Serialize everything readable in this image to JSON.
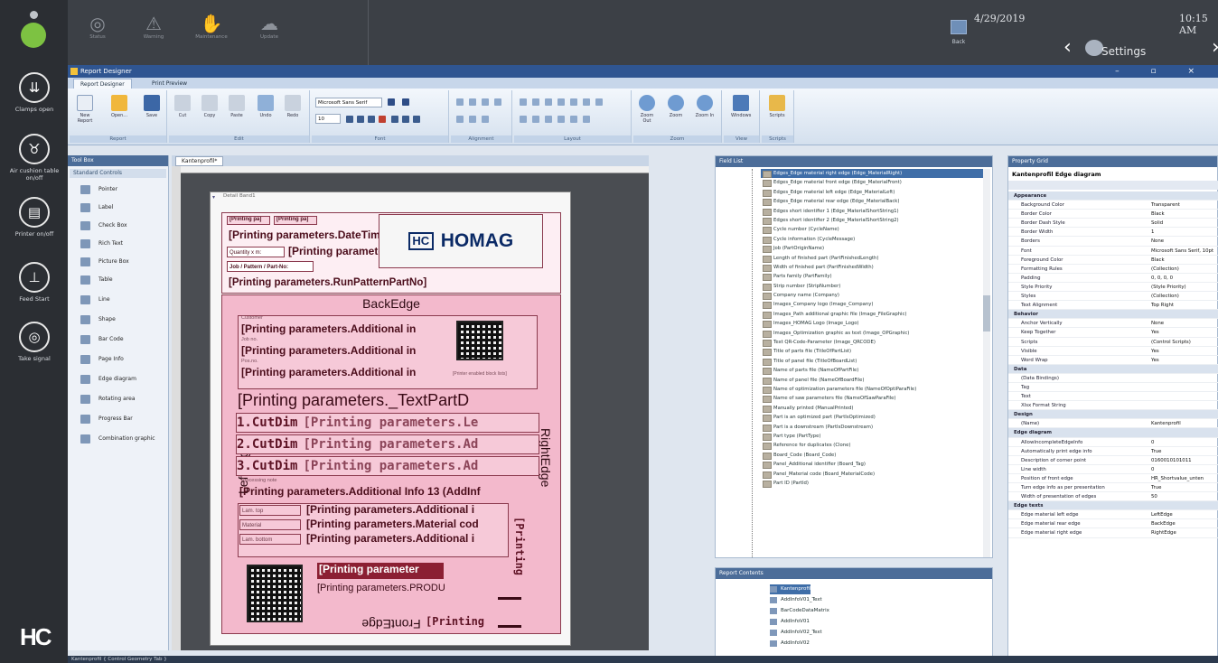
{
  "rail": {
    "buttons": [
      {
        "label": "Clamps open",
        "icon": "clamp-icon"
      },
      {
        "label": "Air cushion table on/off",
        "icon": "air-cushion-icon"
      },
      {
        "label": "Printer on/off",
        "icon": "printer-icon"
      },
      {
        "label": "Feed Start",
        "icon": "feed-start-icon"
      },
      {
        "label": "Take signal",
        "icon": "take-signal-icon"
      }
    ],
    "logo": "HC"
  },
  "topbar": {
    "icons": [
      {
        "label": "Status",
        "icon": "status-icon"
      },
      {
        "label": "Warning",
        "icon": "warning-icon"
      },
      {
        "label": "Maintenance",
        "icon": "maintenance-icon"
      },
      {
        "label": "Update",
        "icon": "update-icon"
      }
    ],
    "back_label": "Back",
    "date": "4/29/2019",
    "time": "10:15 AM",
    "settings_label": "Settings"
  },
  "window": {
    "title": "Report Designer",
    "controls": "– ▫ ×",
    "tabs": [
      "Report Designer",
      "Print Preview"
    ]
  },
  "ribbon": {
    "groups": [
      "Report",
      "Edit",
      "Font",
      "Alignment",
      "Layout",
      "Zoom",
      "View",
      "Scripts"
    ],
    "report_buttons": [
      "New Report",
      "Open...",
      "Save"
    ],
    "edit_buttons": [
      "Cut",
      "Copy",
      "Paste",
      "Undo",
      "Redo"
    ],
    "font_name": "Microsoft Sans Serif",
    "font_size": "10",
    "zoom_buttons": [
      "Zoom Out",
      "Zoom",
      "Zoom In"
    ],
    "view_buttons": [
      "Windows",
      "Scripts"
    ]
  },
  "toolbox": {
    "title": "Tool Box",
    "header": "Standard Controls",
    "items": [
      "Pointer",
      "Label",
      "Check Box",
      "Rich Text",
      "Picture Box",
      "Table",
      "Line",
      "Shape",
      "Bar Code",
      "Page Info",
      "Edge diagram",
      "Rotating area",
      "Progress Bar",
      "Combination graphic"
    ]
  },
  "document": {
    "tab": "Kantenprofil*",
    "band": "Detail Band1",
    "labels": {
      "printing1": "[Printing pa]",
      "printing2": "[Printing pa]",
      "datetime": "[Printing parameters.DateTim",
      "qty_label": "Quantity x m:",
      "qty_value": "[Printing parameter",
      "job_label": "Job / Pattern / Part-No:",
      "runpattern": "[Printing parameters.RunPatternPartNo]",
      "backedge": "BackEdge",
      "leftedge": "LeftEdge",
      "rightedge": "RightEdge",
      "frontedge": "FrontEdge",
      "customer_cap": "Customer",
      "add1": "[Printing parameters.Additional in",
      "jobno_cap": "Job no.",
      "add2": "[Printing parameters.Additional in",
      "posno_cap": "Pos.no.",
      "add3": "[Printing parameters.Additional in",
      "qr_caption": "[Printer enabled block lists]",
      "textpart": "[Printing parameters._TextPartD",
      "cutdim1": "1.CutDim",
      "cutdim1v": "[Printing parameters.Le",
      "cutdim2": "2.CutDim",
      "cutdim2v": "[Printing parameters.Ad",
      "cutdim3": "3.CutDim",
      "cutdim3v": "[Printing parameters.Ad",
      "processing_cap": "Processing note",
      "add13": "[Printing parameters.Additional Info 13 (AddInf",
      "lamtop_cap": "Lam. top",
      "lamtop": "[Printing parameters.Additional i",
      "material_cap": "Material",
      "material": "[Printing parameters.Material cod",
      "lambot_cap": "Lam. bottom",
      "lambot": "[Printing parameters.Additional i",
      "vertical": "[Printing",
      "pp_param": "[Printing parameter",
      "produ": "[Printing parameters.PRODU",
      "printing_bottom": "[Printing"
    },
    "logo_text": "HOMAG"
  },
  "fieldlist": {
    "title": "Field List",
    "items": [
      "Edges_Edge material right edge (Edge_MaterialRight)",
      "Edges_Edge material front edge (Edge_MaterialFront)",
      "Edges_Edge material left edge (Edge_MaterialLeft)",
      "Edges_Edge material rear edge (Edge_MaterialBack)",
      "Edges short identifier 1 (Edge_MaterialShortString1)",
      "Edges short identifier 2 (Edge_MaterialShortString2)",
      "Cycle number (CycleName)",
      "Cycle information (CycleMessage)",
      "Job (PartOriginName)",
      "Length of finished part (PartFinishedLength)",
      "Width of finished part (PartFinishedWidth)",
      "Parts family (PartFamily)",
      "Strip number (StripNumber)",
      "Company name (Company)",
      "Images_Company logo (Image_Company)",
      "Images_Path additional graphic file (Image_FileGraphic)",
      "Images_HOMAG Logo (Image_Logo)",
      "Images_Optimization graphic as text (Image_OPGraphic)",
      "Text QR-Code-Parameter (Image_QRCODE)",
      "Title of parts file (TitleOfPartList)",
      "Title of panel file (TitleOfBoardList)",
      "Name of parts file (NameOfPartFile)",
      "Name of panel file (NameOfBoardFile)",
      "Name of optimization parameters file (NameOfOptiParaFile)",
      "Name of saw parameters file (NameOfSawParaFile)",
      "Manually printed (ManualPrinted)",
      "Part is an optimized part (PartIsOptimized)",
      "Part is a downstream (PartIsDownstream)",
      "Part type (PartType)",
      "Reference for duplicates (Clone)",
      "Board_Code (Board_Code)",
      "Panel_Additional identifier (Board_Tag)",
      "Panel_Material code (Board_MaterialCode)",
      "Part ID (PartId)"
    ]
  },
  "report_content": {
    "title": "Report Contents",
    "items": [
      "Kantenprofil",
      "AddInfoV01_Text",
      "BarCodeDataMatrix",
      "AddInfoV01",
      "AddInfoV02_Text",
      "AddInfoV02"
    ]
  },
  "property_grid": {
    "title": "Property Grid",
    "object_name": "Kantenprofil Edge diagram",
    "rows": [
      {
        "k": "Appearance",
        "v": "",
        "cat": true
      },
      {
        "k": "Background Color",
        "v": "Transparent"
      },
      {
        "k": "Border Color",
        "v": "Black"
      },
      {
        "k": "Border Dash Style",
        "v": "Solid"
      },
      {
        "k": "Border Width",
        "v": "1"
      },
      {
        "k": "Borders",
        "v": "None"
      },
      {
        "k": "Font",
        "v": "Microsoft Sans Serif, 10pt"
      },
      {
        "k": "Foreground Color",
        "v": "Black"
      },
      {
        "k": "Formatting Rules",
        "v": "(Collection)"
      },
      {
        "k": "Padding",
        "v": "0, 0, 0, 0"
      },
      {
        "k": "Style Priority",
        "v": "(Style Priority)"
      },
      {
        "k": "Styles",
        "v": "(Collection)"
      },
      {
        "k": "Text Alignment",
        "v": "Top Right"
      },
      {
        "k": "Behavior",
        "v": "",
        "cat": true
      },
      {
        "k": "Anchor Vertically",
        "v": "None"
      },
      {
        "k": "Keep Together",
        "v": "Yes"
      },
      {
        "k": "Scripts",
        "v": "(Control Scripts)"
      },
      {
        "k": "Visible",
        "v": "Yes"
      },
      {
        "k": "Word Wrap",
        "v": "Yes"
      },
      {
        "k": "Data",
        "v": "",
        "cat": true
      },
      {
        "k": "(Data Bindings)",
        "v": ""
      },
      {
        "k": "Tag",
        "v": ""
      },
      {
        "k": "Text",
        "v": ""
      },
      {
        "k": "Xlsx Format String",
        "v": ""
      },
      {
        "k": "Design",
        "v": "",
        "cat": true
      },
      {
        "k": "(Name)",
        "v": "Kantenprofil"
      },
      {
        "k": "Edge diagram",
        "v": "",
        "cat": true
      },
      {
        "k": "AllowIncompleteEdgeInfo",
        "v": "0"
      },
      {
        "k": "Automatically print edge info",
        "v": "True"
      },
      {
        "k": "Description of corner point",
        "v": "0160010101011"
      },
      {
        "k": "Line width",
        "v": "0"
      },
      {
        "k": "Position of front edge",
        "v": "HR_Shortvalue_unten"
      },
      {
        "k": "Turn edge info as per presentation",
        "v": "True"
      },
      {
        "k": "Width of presentation of edges",
        "v": "50"
      },
      {
        "k": "Edge texts",
        "v": "",
        "cat": true
      },
      {
        "k": "Edge material left edge",
        "v": "LeftEdge"
      },
      {
        "k": "Edge material rear edge",
        "v": "BackEdge"
      },
      {
        "k": "Edge material right edge",
        "v": "RightEdge"
      }
    ]
  },
  "status": {
    "text": "Kantenprofil { Control Geometry Tab }"
  }
}
